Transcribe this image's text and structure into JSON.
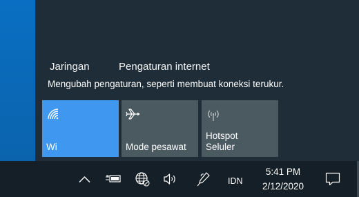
{
  "panel": {
    "link_network": "Jaringan",
    "link_internet_settings": "Pengaturan internet",
    "description": "Mengubah pengaturan, seperti membuat koneksi terukur."
  },
  "tiles": [
    {
      "label": "Wi",
      "icon": "wifi-icon",
      "active": true
    },
    {
      "label": "Mode pesawat",
      "icon": "airplane-icon",
      "active": false
    },
    {
      "label": "Hotspot\nSeluler",
      "icon": "mobile-hotspot-icon",
      "active": false
    }
  ],
  "taskbar": {
    "language": "IDN",
    "time": "5:41 PM",
    "date": "2/12/2020",
    "tray_icons": [
      "chevron-up-icon",
      "power-battery-icon",
      "network-globe-icon",
      "volume-icon",
      "pen-icon",
      "action-center-icon"
    ]
  },
  "colors": {
    "accent": "#3f97f0",
    "panel": "#1e2d37",
    "tile_inactive": "#4b5961",
    "taskbar": "#151f27"
  }
}
